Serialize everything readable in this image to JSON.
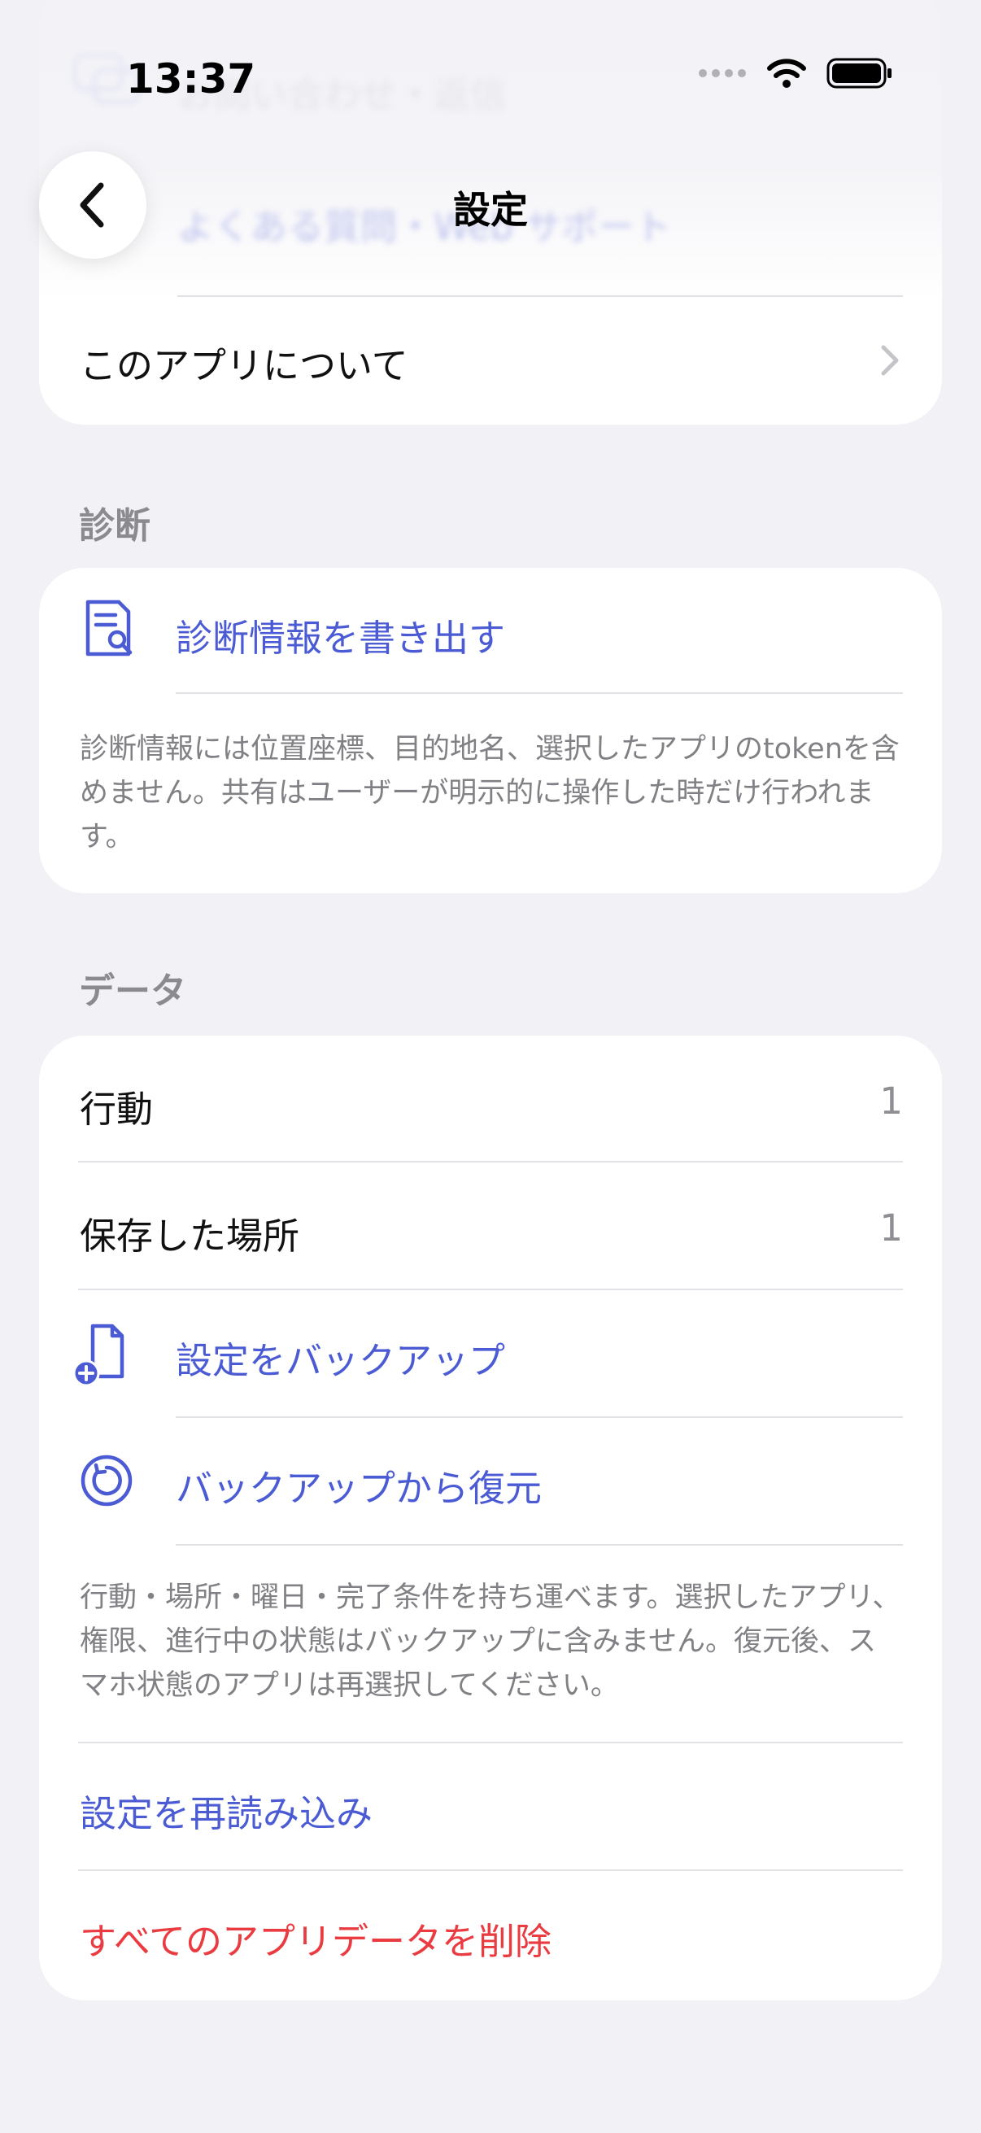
{
  "status_bar": {
    "time": "13:37"
  },
  "nav": {
    "title": "設定",
    "back_icon": "chevron-left-icon"
  },
  "support_card": {
    "items": [
      {
        "label": "お問い合わせ・返信",
        "icon": "chat-bubbles-icon"
      },
      {
        "label": "よくある質問・Web サポート",
        "icon": "globe-icon"
      },
      {
        "label": "このアプリについて"
      }
    ]
  },
  "diagnostics": {
    "section_title": "診断",
    "export_label": "診断情報を書き出す",
    "export_icon": "document-search-icon",
    "footnote": "診断情報には位置座標、目的地名、選択したアプリのtokenを含めません。共有はユーザーが明示的に操作した時だけ行われます。"
  },
  "data_section": {
    "section_title": "データ",
    "actions_label": "行動",
    "actions_count": "1",
    "places_label": "保存した場所",
    "places_count": "1",
    "backup_label": "設定をバックアップ",
    "backup_icon": "document-add-icon",
    "restore_label": "バックアップから復元",
    "restore_icon": "restore-icon",
    "footnote": "行動・場所・曜日・完了条件を持ち運べます。選択したアプリ、権限、進行中の状態はバックアップに含みません。復元後、スマホ状態のアプリは再選択してください。",
    "reload_label": "設定を再読み込み",
    "delete_label": "すべてのアプリデータを削除"
  },
  "colors": {
    "accent": "#4a5bd4",
    "danger": "#ea3b41",
    "background": "#f1f1f6",
    "card": "#ffffff",
    "secondary_text": "#8e8e93"
  }
}
